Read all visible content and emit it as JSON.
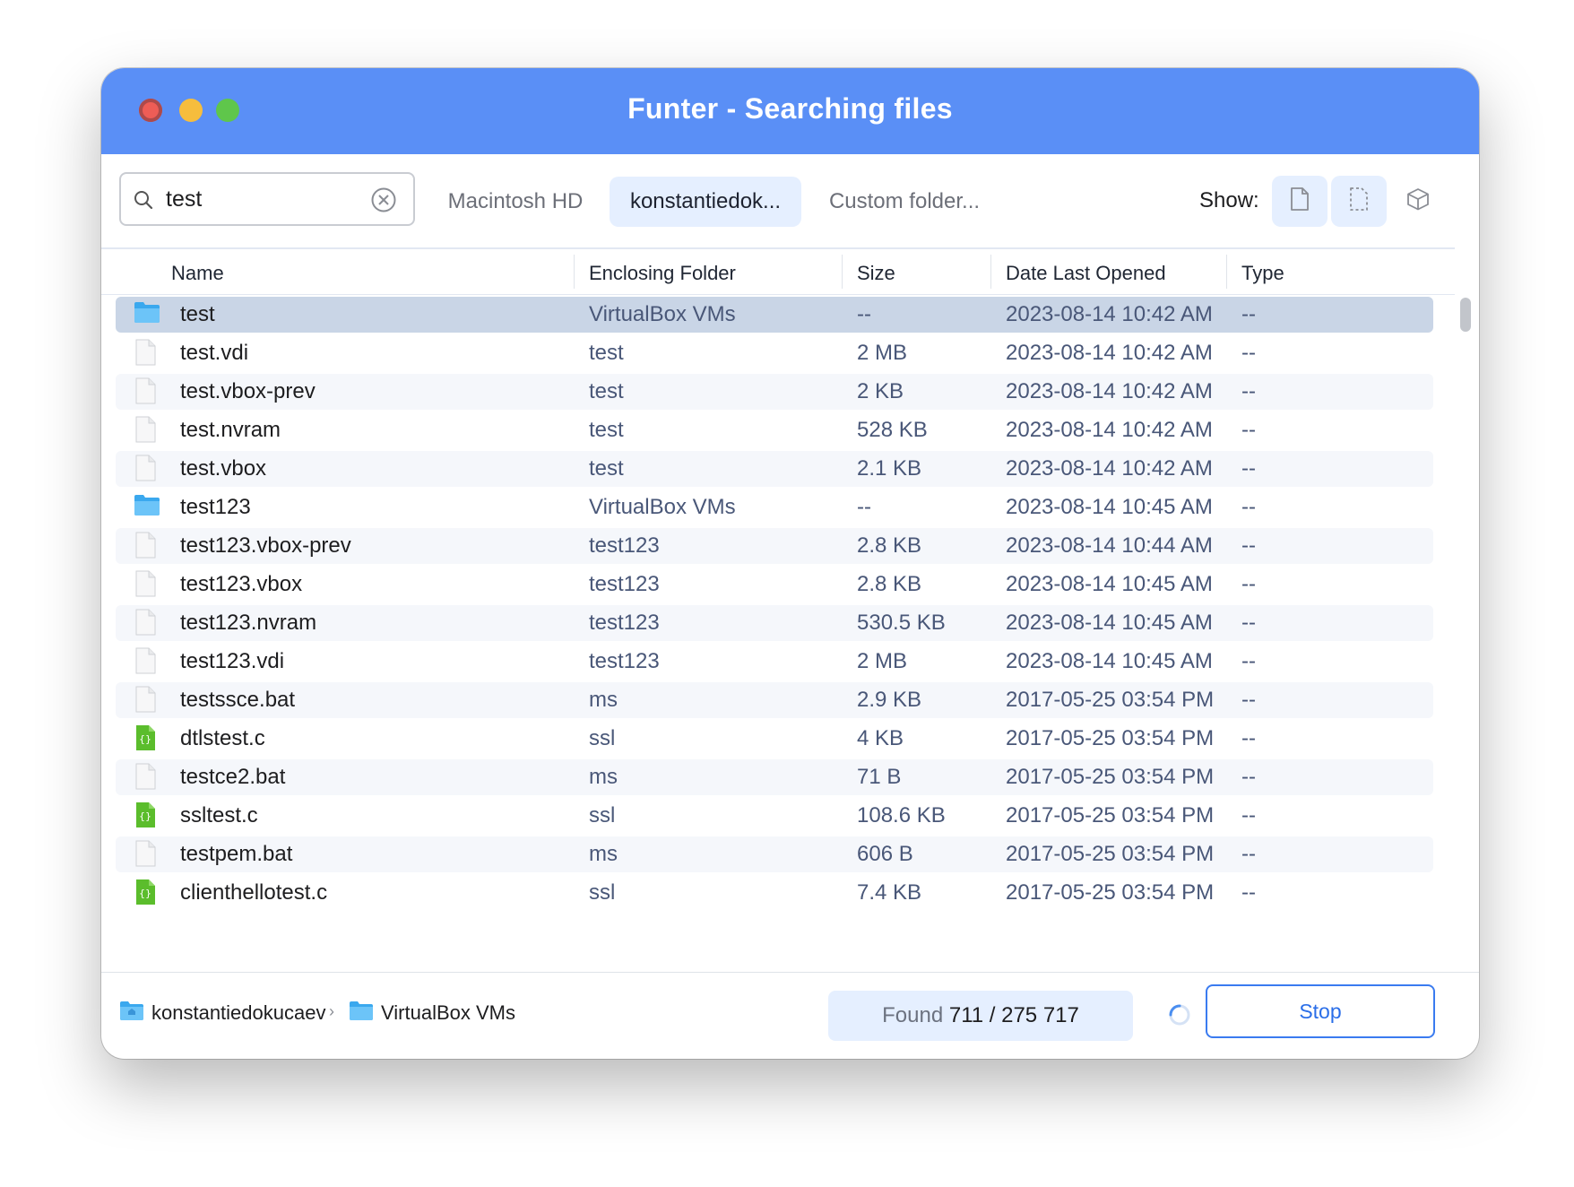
{
  "window": {
    "title": "Funter - Searching files"
  },
  "search": {
    "query": "test"
  },
  "tabs": [
    {
      "label": "Macintosh HD",
      "active": false
    },
    {
      "label": "konstantiedok...",
      "active": true
    },
    {
      "label": "Custom folder...",
      "active": false
    }
  ],
  "show": {
    "label": "Show:",
    "buttons": [
      "file-icon",
      "hidden-file-icon",
      "package-icon"
    ]
  },
  "columns": {
    "name": "Name",
    "folder": "Enclosing Folder",
    "size": "Size",
    "date": "Date Last Opened",
    "type": "Type"
  },
  "rows": [
    {
      "icon": "folder-icon",
      "name": "test",
      "folder": "VirtualBox VMs",
      "size": "--",
      "date": "2023-08-14 10:42 AM",
      "type": "--"
    },
    {
      "icon": "file-icon",
      "name": "test.vdi",
      "folder": "test",
      "size": "2 MB",
      "date": "2023-08-14 10:42 AM",
      "type": "--"
    },
    {
      "icon": "file-icon",
      "name": "test.vbox-prev",
      "folder": "test",
      "size": "2 KB",
      "date": "2023-08-14 10:42 AM",
      "type": "--"
    },
    {
      "icon": "file-icon",
      "name": "test.nvram",
      "folder": "test",
      "size": "528 KB",
      "date": "2023-08-14 10:42 AM",
      "type": "--"
    },
    {
      "icon": "file-icon",
      "name": "test.vbox",
      "folder": "test",
      "size": "2.1 KB",
      "date": "2023-08-14 10:42 AM",
      "type": "--"
    },
    {
      "icon": "folder-icon",
      "name": "test123",
      "folder": "VirtualBox VMs",
      "size": "--",
      "date": "2023-08-14 10:45 AM",
      "type": "--"
    },
    {
      "icon": "file-icon",
      "name": "test123.vbox-prev",
      "folder": "test123",
      "size": "2.8 KB",
      "date": "2023-08-14 10:44 AM",
      "type": "--"
    },
    {
      "icon": "file-icon",
      "name": "test123.vbox",
      "folder": "test123",
      "size": "2.8 KB",
      "date": "2023-08-14 10:45 AM",
      "type": "--"
    },
    {
      "icon": "file-icon",
      "name": "test123.nvram",
      "folder": "test123",
      "size": "530.5 KB",
      "date": "2023-08-14 10:45 AM",
      "type": "--"
    },
    {
      "icon": "file-icon",
      "name": "test123.vdi",
      "folder": "test123",
      "size": "2 MB",
      "date": "2023-08-14 10:45 AM",
      "type": "--"
    },
    {
      "icon": "file-icon",
      "name": "testssce.bat",
      "folder": "ms",
      "size": "2.9 KB",
      "date": "2017-05-25 03:54 PM",
      "type": "--"
    },
    {
      "icon": "c-source-icon",
      "name": "dtlstest.c",
      "folder": "ssl",
      "size": "4 KB",
      "date": "2017-05-25 03:54 PM",
      "type": "--"
    },
    {
      "icon": "file-icon",
      "name": "testce2.bat",
      "folder": "ms",
      "size": "71 B",
      "date": "2017-05-25 03:54 PM",
      "type": "--"
    },
    {
      "icon": "c-source-icon",
      "name": "ssltest.c",
      "folder": "ssl",
      "size": "108.6 KB",
      "date": "2017-05-25 03:54 PM",
      "type": "--"
    },
    {
      "icon": "file-icon",
      "name": "testpem.bat",
      "folder": "ms",
      "size": "606 B",
      "date": "2017-05-25 03:54 PM",
      "type": "--"
    },
    {
      "icon": "c-source-icon",
      "name": "clienthellotest.c",
      "folder": "ssl",
      "size": "7.4 KB",
      "date": "2017-05-25 03:54 PM",
      "type": "--"
    }
  ],
  "footer": {
    "path": [
      "konstantiedokucaev",
      "VirtualBox VMs"
    ],
    "found_label": "Found",
    "found_count": "711 / 275 717",
    "stop_label": "Stop"
  }
}
